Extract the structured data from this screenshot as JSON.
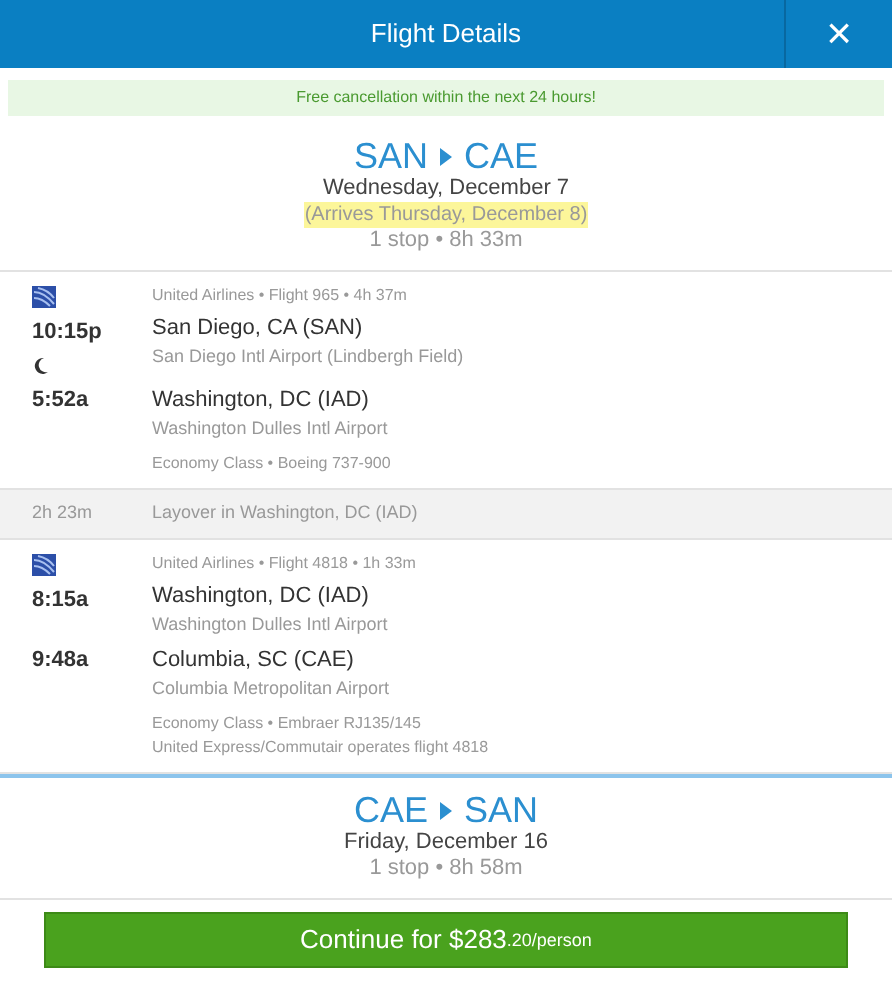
{
  "header": {
    "title": "Flight Details",
    "close": "×"
  },
  "banner": "Free cancellation within the next 24 hours!",
  "outbound": {
    "from": "SAN",
    "to": "CAE",
    "date": "Wednesday, December 7",
    "arrival_note": "(Arrives Thursday, December 8)",
    "summary": "1 stop • 8h 33m",
    "segments": [
      {
        "kind": "flight",
        "info": "United Airlines • Flight 965 • 4h 37m",
        "overnight": true,
        "depart_time": "10:15p",
        "depart_city": "San Diego, CA (SAN)",
        "depart_airport": "San Diego Intl Airport (Lindbergh Field)",
        "arrive_time": "5:52a",
        "arrive_city": "Washington, DC (IAD)",
        "arrive_airport": "Washington Dulles Intl Airport",
        "notes": [
          "Economy Class • Boeing 737-900"
        ]
      },
      {
        "kind": "layover",
        "duration": "2h 23m",
        "text": "Layover in Washington, DC (IAD)"
      },
      {
        "kind": "flight",
        "info": "United Airlines • Flight 4818 • 1h 33m",
        "overnight": false,
        "depart_time": "8:15a",
        "depart_city": "Washington, DC (IAD)",
        "depart_airport": "Washington Dulles Intl Airport",
        "arrive_time": "9:48a",
        "arrive_city": "Columbia, SC (CAE)",
        "arrive_airport": "Columbia Metropolitan Airport",
        "notes": [
          "Economy Class • Embraer RJ135/145",
          "United Express/Commutair operates flight 4818"
        ]
      }
    ]
  },
  "return": {
    "from": "CAE",
    "to": "SAN",
    "date": "Friday, December 16",
    "summary": "1 stop • 8h 58m"
  },
  "continue_button": {
    "label": "Continue for $283",
    "suffix": ".20/person"
  }
}
